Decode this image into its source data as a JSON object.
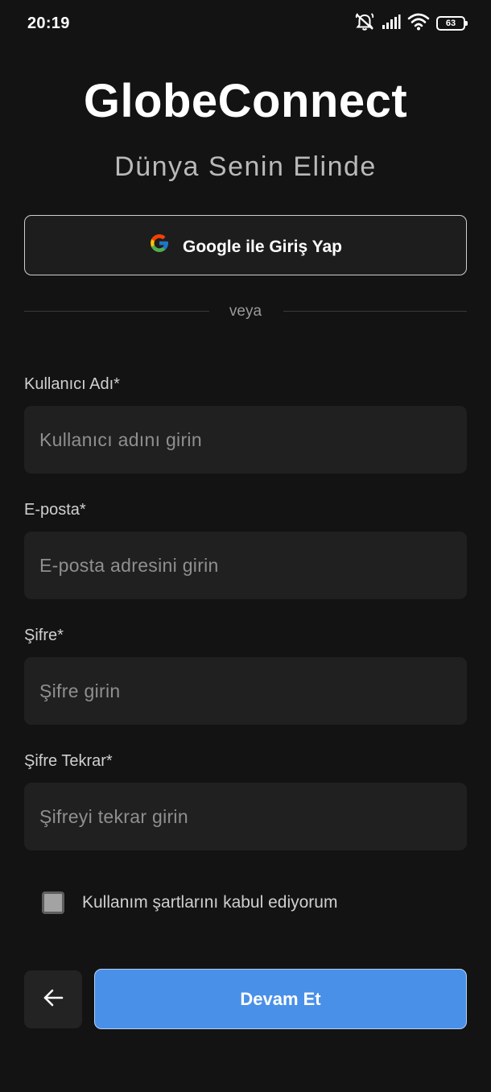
{
  "status_bar": {
    "time": "20:19",
    "battery": "63"
  },
  "header": {
    "title": "GlobeConnect",
    "subtitle": "Dünya Senin Elinde"
  },
  "google_signin": {
    "label": "Google ile Giriş Yap"
  },
  "divider": {
    "text": "veya"
  },
  "form": {
    "username": {
      "label": "Kullanıcı Adı*",
      "placeholder": "Kullanıcı adını girin",
      "value": ""
    },
    "email": {
      "label": "E-posta*",
      "placeholder": "E-posta adresini girin",
      "value": ""
    },
    "password": {
      "label": "Şifre*",
      "placeholder": "Şifre girin",
      "value": ""
    },
    "password_repeat": {
      "label": "Şifre Tekrar*",
      "placeholder": "Şifreyi tekrar girin",
      "value": ""
    }
  },
  "terms": {
    "label": "Kullanım şartlarını kabul ediyorum",
    "checked": false
  },
  "actions": {
    "back_icon": "arrow-left-icon",
    "continue_label": "Devam Et"
  },
  "colors": {
    "background": "#131313",
    "input_background": "#202020",
    "accent": "#4990e8"
  }
}
